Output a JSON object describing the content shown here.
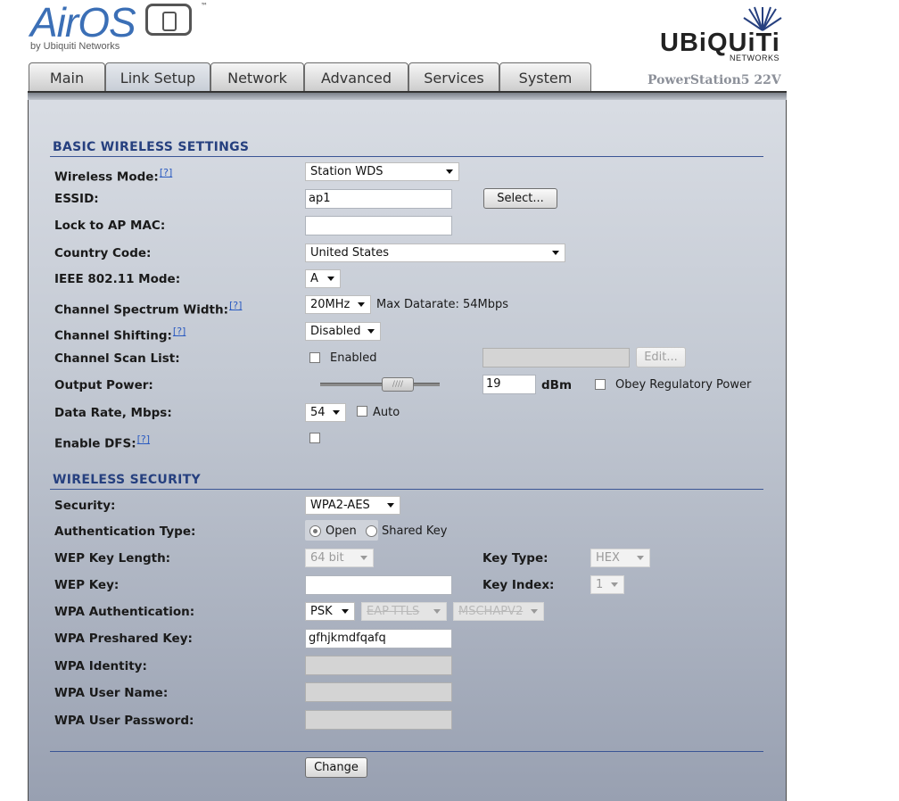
{
  "header": {
    "airos_logo": "AirOS",
    "airos_by": "by Ubiquiti Networks",
    "airos_tm": "™",
    "ubnt_logo": "UBiQUiTi",
    "ubnt_sub": "NETWORKS",
    "device_name": "PowerStation5 22V"
  },
  "tabs": [
    {
      "label": "Main"
    },
    {
      "label": "Link Setup",
      "active": true
    },
    {
      "label": "Network"
    },
    {
      "label": "Advanced"
    },
    {
      "label": "Services"
    },
    {
      "label": "System"
    }
  ],
  "basic": {
    "title": "BASIC WIRELESS SETTINGS",
    "help": "[?]",
    "wireless_mode": {
      "label": "Wireless Mode:",
      "value": "Station WDS"
    },
    "essid": {
      "label": "ESSID:",
      "value": "ap1",
      "select_button": "Select..."
    },
    "lock_mac": {
      "label": "Lock to AP MAC:",
      "value": ""
    },
    "country": {
      "label": "Country Code:",
      "value": "United States"
    },
    "ieee_mode": {
      "label": "IEEE 802.11 Mode:",
      "value": "A"
    },
    "spectrum": {
      "label": "Channel Spectrum Width:",
      "value": "20MHz",
      "max_datarate": "Max Datarate: 54Mbps"
    },
    "shifting": {
      "label": "Channel Shifting:",
      "value": "Disabled"
    },
    "scan_list": {
      "label": "Channel Scan List:",
      "enabled_label": "Enabled",
      "edit_button": "Edit..."
    },
    "output_power": {
      "label": "Output Power:",
      "value": "19",
      "unit": "dBm",
      "obey_label": "Obey Regulatory Power",
      "slider_grip": "////"
    },
    "data_rate": {
      "label": "Data Rate, Mbps:",
      "value": "54",
      "auto_label": "Auto"
    },
    "dfs": {
      "label": "Enable DFS:"
    }
  },
  "security": {
    "title": "WIRELESS SECURITY",
    "security": {
      "label": "Security:",
      "value": "WPA2-AES"
    },
    "auth_type": {
      "label": "Authentication Type:",
      "open": "Open",
      "shared": "Shared Key"
    },
    "wep_len": {
      "label": "WEP Key Length:",
      "value": "64 bit"
    },
    "key_type": {
      "label": "Key Type:",
      "value": "HEX"
    },
    "wep_key": {
      "label": "WEP Key:",
      "value": ""
    },
    "key_index": {
      "label": "Key Index:",
      "value": "1"
    },
    "wpa_auth": {
      "label": "WPA Authentication:",
      "value": "PSK",
      "eap": "EAP-TTLS",
      "inner": "MSCHAPV2"
    },
    "wpa_psk": {
      "label": "WPA Preshared Key:",
      "value": "gfhjkmdfqafq"
    },
    "wpa_identity": {
      "label": "WPA Identity:"
    },
    "wpa_user": {
      "label": "WPA User Name:"
    },
    "wpa_pass": {
      "label": "WPA User Password:"
    }
  },
  "change_button": "Change"
}
